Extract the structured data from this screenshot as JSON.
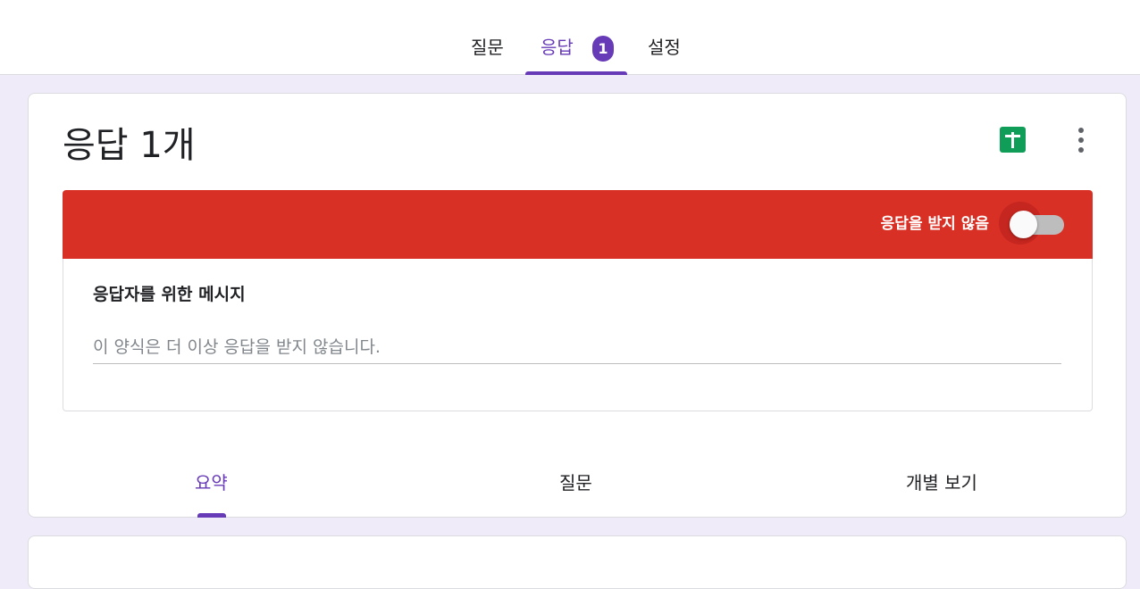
{
  "top_tabs": {
    "questions": "질문",
    "responses": "응답",
    "responses_badge": "1",
    "settings": "설정"
  },
  "card": {
    "title": "응답 1개",
    "sheets_icon": "google-sheets-icon",
    "more_icon": "more-vert-icon"
  },
  "banner": {
    "label": "응답을 받지 않음",
    "accepting_responses": false,
    "color": "#d93025"
  },
  "message": {
    "label": "응답자를 위한 메시지",
    "value": "",
    "placeholder": "이 양식은 더 이상 응답을 받지 않습니다."
  },
  "sub_tabs": {
    "summary": "요약",
    "question": "질문",
    "individual": "개별 보기",
    "active": "summary"
  },
  "colors": {
    "accent": "#673ab7",
    "background": "#f0ebf8",
    "sheets_green": "#0f9d58"
  }
}
